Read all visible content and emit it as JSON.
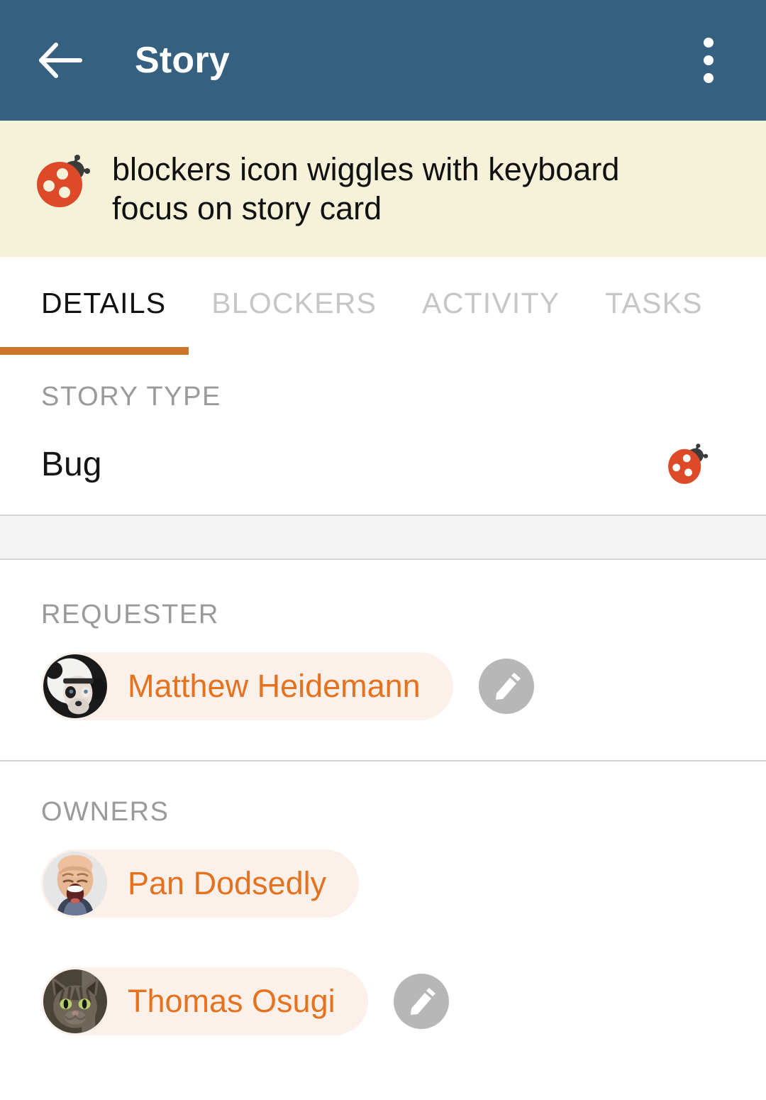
{
  "theme": {
    "appbar_color": "#35607F",
    "banner_color": "#F6F2D9",
    "accent_color": "#CC7429",
    "chip_text_color": "#E5721F",
    "chip_bg_color": "#FCF1EA",
    "muted_text_color": "#9A9A9A"
  },
  "appbar": {
    "back_icon": "back-arrow-icon",
    "title": "Story",
    "overflow_icon": "overflow-menu-icon"
  },
  "banner": {
    "icon": "ladybug-icon",
    "text": "blockers icon wiggles with keyboard focus on story card"
  },
  "tabs": [
    {
      "label": "DETAILS",
      "active": true
    },
    {
      "label": "BLOCKERS",
      "active": false
    },
    {
      "label": "ACTIVITY",
      "active": false
    },
    {
      "label": "TASKS",
      "active": false
    }
  ],
  "details": {
    "story_type": {
      "label": "STORY TYPE",
      "value": "Bug",
      "icon": "ladybug-icon"
    },
    "requester": {
      "label": "REQUESTER",
      "person": {
        "name": "Matthew Heidemann",
        "avatar": "panda-avatar"
      },
      "edit_icon": "pencil-icon"
    },
    "owners": {
      "label": "OWNERS",
      "people": [
        {
          "name": "Pan Dodsedly",
          "avatar": "laughing-man-avatar"
        },
        {
          "name": "Thomas Osugi",
          "avatar": "cat-avatar"
        }
      ],
      "edit_icon": "pencil-icon"
    }
  }
}
